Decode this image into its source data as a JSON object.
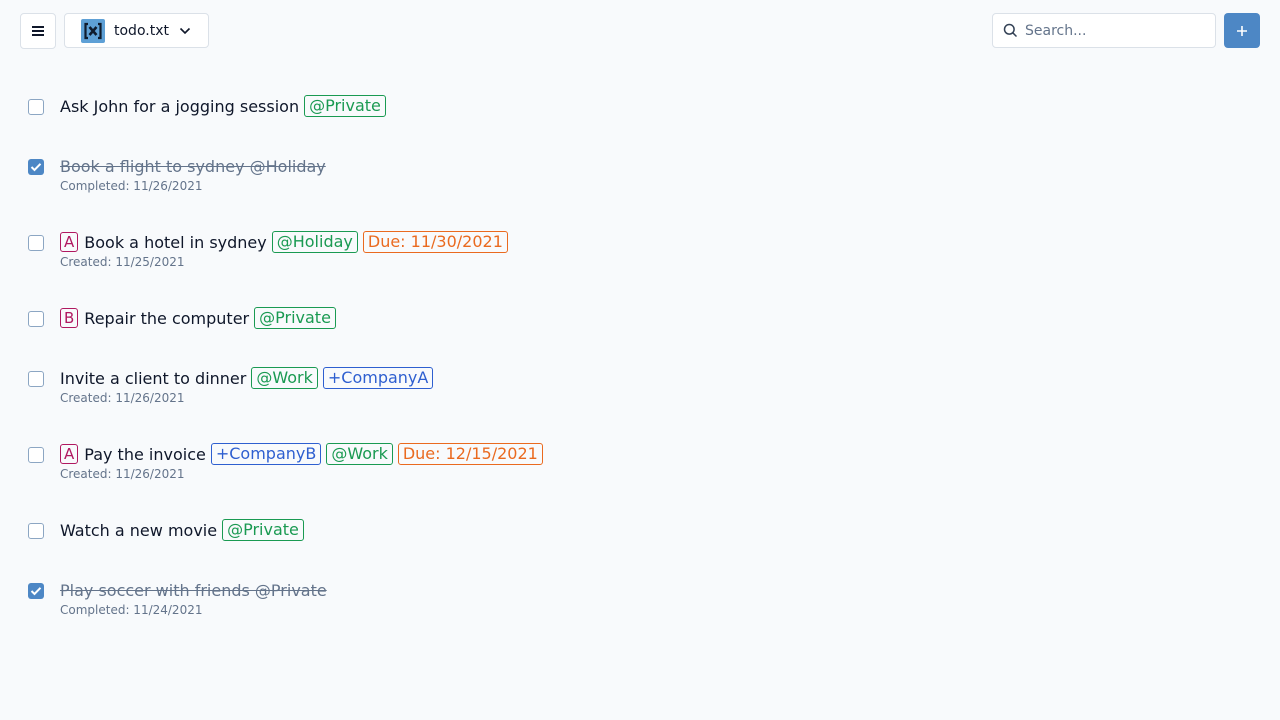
{
  "header": {
    "file_name": "todo.txt",
    "logo_text": "[x]",
    "search_placeholder": "Search...",
    "add_label": "+"
  },
  "colors": {
    "background": "#f8fafc",
    "accent": "#4d87c5",
    "priority": "#b01860",
    "context_tag": "#1a9a52",
    "project_tag": "#2e5fd0",
    "due_tag": "#ea6a1f",
    "muted_text": "#64748b"
  },
  "tasks": [
    {
      "completed": false,
      "text": "Ask John for a jogging session",
      "tags": [
        {
          "type": "context",
          "label": "@Private"
        }
      ]
    },
    {
      "completed": true,
      "text": "Book a flight to sydney @Holiday",
      "meta": "Completed: 11/26/2021"
    },
    {
      "completed": false,
      "priority": "A",
      "text": "Book a hotel in sydney",
      "tags": [
        {
          "type": "context",
          "label": "@Holiday"
        },
        {
          "type": "due",
          "label": "Due: 11/30/2021"
        }
      ],
      "meta": "Created: 11/25/2021"
    },
    {
      "completed": false,
      "priority": "B",
      "text": "Repair the computer",
      "tags": [
        {
          "type": "context",
          "label": "@Private"
        }
      ]
    },
    {
      "completed": false,
      "text": "Invite a client to dinner",
      "tags": [
        {
          "type": "context",
          "label": "@Work"
        },
        {
          "type": "project",
          "label": "+CompanyA"
        }
      ],
      "meta": "Created: 11/26/2021"
    },
    {
      "completed": false,
      "priority": "A",
      "text": "Pay the invoice",
      "tags": [
        {
          "type": "project",
          "label": "+CompanyB"
        },
        {
          "type": "context",
          "label": "@Work"
        },
        {
          "type": "due",
          "label": "Due: 12/15/2021"
        }
      ],
      "meta": "Created: 11/26/2021"
    },
    {
      "completed": false,
      "text": "Watch a new movie",
      "tags": [
        {
          "type": "context",
          "label": "@Private"
        }
      ]
    },
    {
      "completed": true,
      "text": "Play soccer with friends @Private",
      "meta": "Completed: 11/24/2021"
    }
  ]
}
